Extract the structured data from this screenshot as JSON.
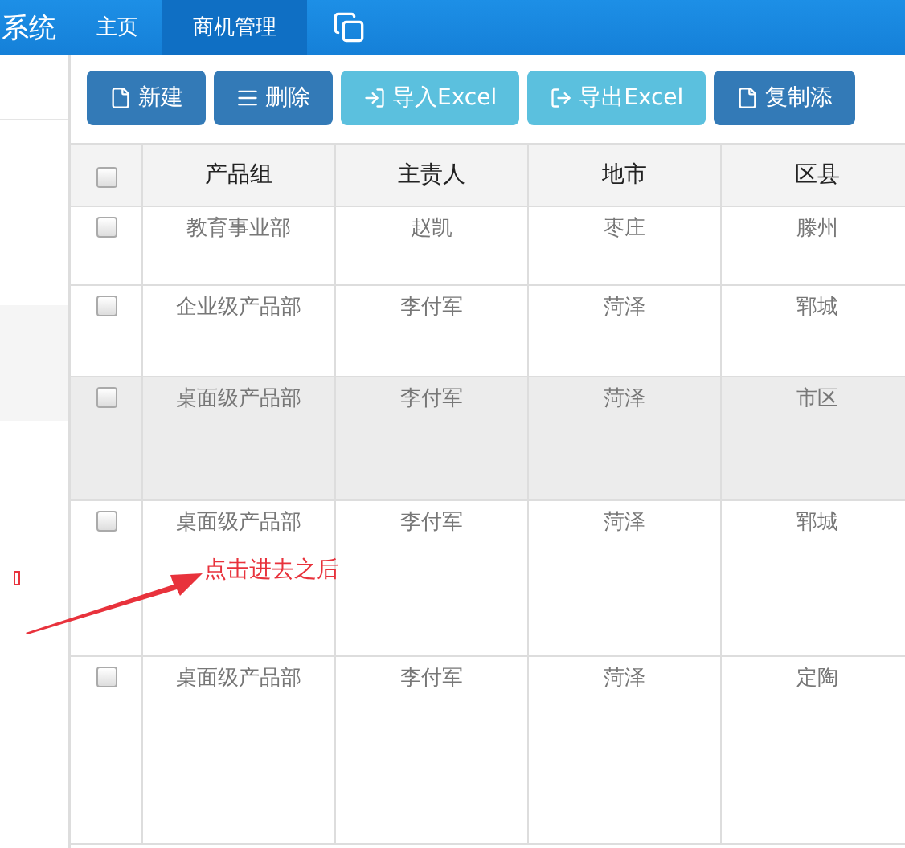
{
  "header": {
    "title": "系统",
    "tabs": [
      {
        "label": "主页",
        "selected": false
      },
      {
        "label": "商机管理",
        "selected": true
      }
    ]
  },
  "toolbar": {
    "buttons": [
      {
        "label": "新建",
        "kind": "primary"
      },
      {
        "label": "删除",
        "kind": "primary"
      },
      {
        "label": "导入Excel",
        "kind": "info"
      },
      {
        "label": "导出Excel",
        "kind": "info"
      },
      {
        "label": "复制添",
        "kind": "primary"
      }
    ]
  },
  "table": {
    "header_checked": false,
    "columns": [
      "产品组",
      "主责人",
      "地市",
      "区县"
    ],
    "rows": [
      {
        "checked": false,
        "highlighted": false,
        "cells": [
          "教育事业部",
          "赵凯",
          "枣庄",
          "滕州"
        ]
      },
      {
        "checked": false,
        "highlighted": false,
        "cells": [
          "企业级产品部",
          "李付军",
          "菏泽",
          "郓城"
        ]
      },
      {
        "checked": false,
        "highlighted": true,
        "cells": [
          "桌面级产品部",
          "李付军",
          "菏泽",
          "市区"
        ]
      },
      {
        "checked": false,
        "highlighted": false,
        "cells": [
          "桌面级产品部",
          "李付军",
          "菏泽",
          "郓城"
        ]
      },
      {
        "checked": false,
        "highlighted": false,
        "cells": [
          "桌面级产品部",
          "李付军",
          "菏泽",
          "定陶"
        ]
      }
    ]
  },
  "annotation": {
    "text": "点击进去之后"
  }
}
